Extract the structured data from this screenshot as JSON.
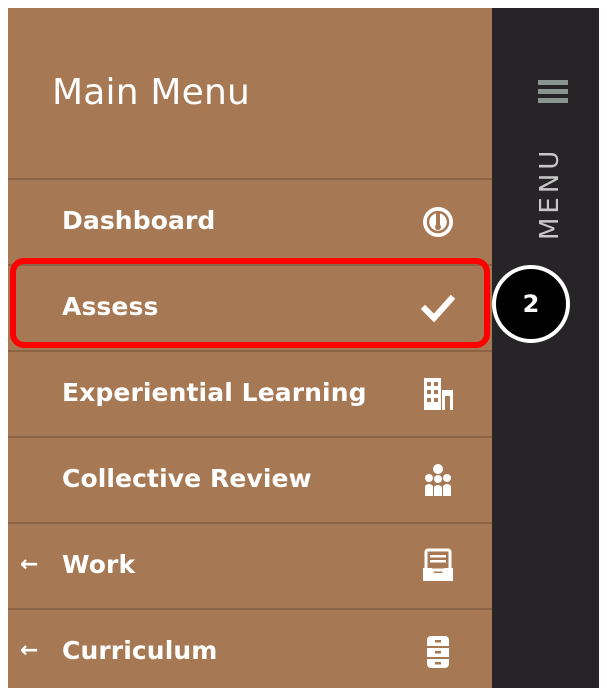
{
  "menu": {
    "title": "Main Menu",
    "rail_label": "MENU",
    "items": [
      {
        "label": "Dashboard",
        "icon": "dashboard-gauge-icon",
        "arrow": ""
      },
      {
        "label": "Assess",
        "icon": "checkmark-icon",
        "arrow": ""
      },
      {
        "label": "Experiential Learning",
        "icon": "building-icon",
        "arrow": ""
      },
      {
        "label": "Collective Review",
        "icon": "group-icon",
        "arrow": ""
      },
      {
        "label": "Work",
        "icon": "inbox-tray-icon",
        "arrow": "←"
      },
      {
        "label": "Curriculum",
        "icon": "cabinet-icon",
        "arrow": "←"
      }
    ]
  },
  "annotation": {
    "step_number": "2",
    "highlight_color": "#ff0000"
  },
  "colors": {
    "panel": "#a67954",
    "rail": "#262426",
    "text": "#ffffff"
  }
}
